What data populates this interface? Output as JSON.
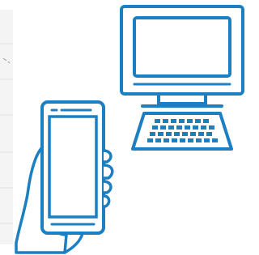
{
  "colors": {
    "line_blue": "#1b7fc1",
    "panel_bg": "#f4f4f4",
    "panel_divider": "#e1e1e1",
    "page_bg": "#ffffff"
  },
  "illustration": {
    "elements": [
      "background-list-panel",
      "desktop-computer-icon",
      "keyboard-icon",
      "hand-icon",
      "smartphone-icon"
    ]
  }
}
